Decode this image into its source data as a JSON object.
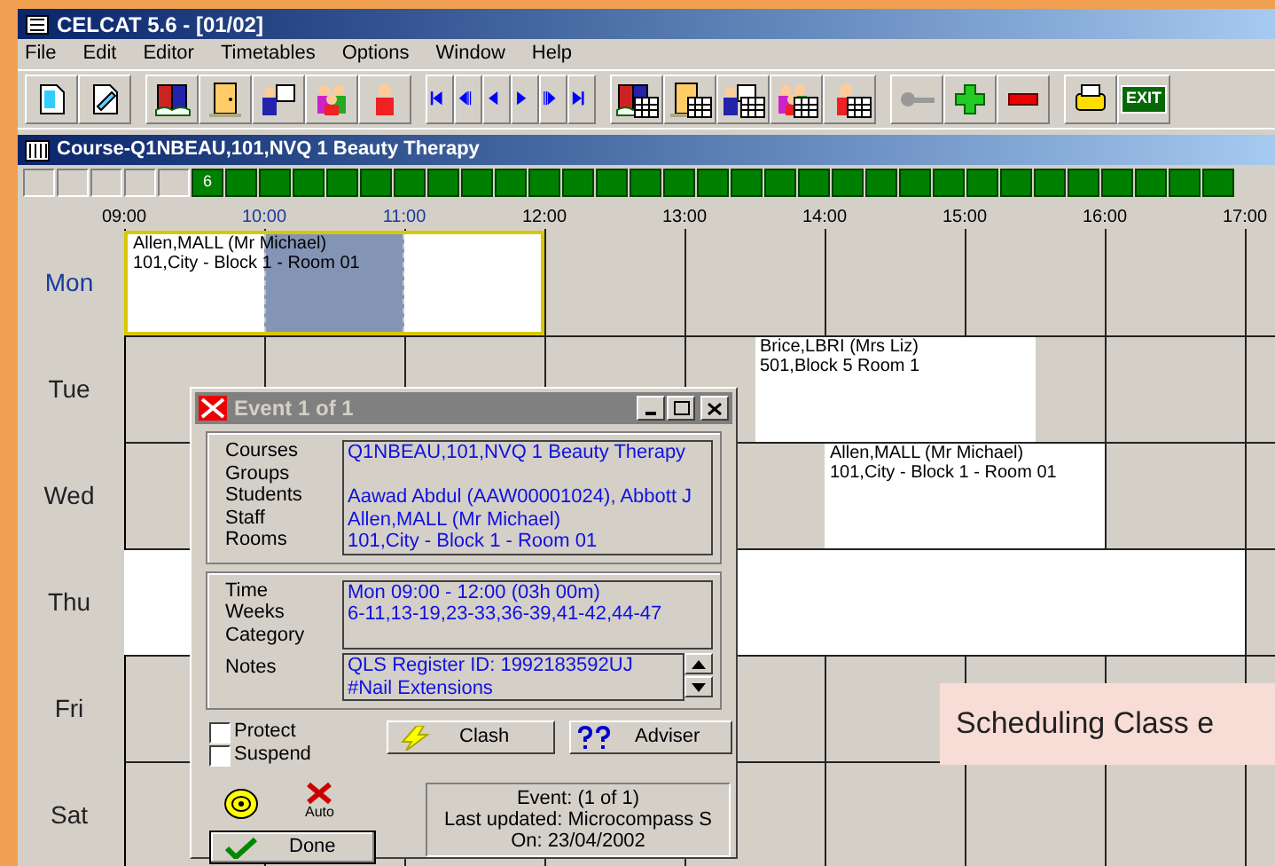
{
  "app": {
    "title": "CELCAT 5.6 - [01/02]"
  },
  "menu": [
    "File",
    "Edit",
    "Editor",
    "Timetables",
    "Options",
    "Window",
    "Help"
  ],
  "toolbar": {
    "exit_label": "EXIT"
  },
  "timetable": {
    "title": "Course-Q1NBEAU,101,NVQ 1 Beauty Therapy",
    "weeks": [
      {
        "active": false
      },
      {
        "active": false
      },
      {
        "active": false
      },
      {
        "active": false
      },
      {
        "active": false
      },
      {
        "label": "6",
        "active": true
      },
      {
        "active": true
      },
      {
        "active": true
      },
      {
        "active": true
      },
      {
        "active": true
      },
      {
        "active": true
      },
      {
        "active": true
      },
      {
        "active": true
      },
      {
        "active": true
      },
      {
        "active": true
      },
      {
        "active": true
      },
      {
        "active": true
      },
      {
        "active": true
      },
      {
        "active": true
      },
      {
        "active": true
      },
      {
        "active": true
      },
      {
        "active": true
      },
      {
        "active": true
      },
      {
        "active": true
      },
      {
        "active": true
      },
      {
        "active": true
      },
      {
        "active": true
      },
      {
        "active": true
      },
      {
        "active": true
      },
      {
        "active": true
      },
      {
        "active": true
      },
      {
        "active": true
      },
      {
        "active": true
      },
      {
        "active": true
      },
      {
        "active": true
      },
      {
        "active": true
      }
    ],
    "hours": [
      {
        "label": "09:00",
        "selected": false
      },
      {
        "label": "10:00",
        "selected": true
      },
      {
        "label": "11:00",
        "selected": true
      },
      {
        "label": "12:00",
        "selected": false
      },
      {
        "label": "13:00",
        "selected": false
      },
      {
        "label": "14:00",
        "selected": false
      },
      {
        "label": "15:00",
        "selected": false
      },
      {
        "label": "16:00",
        "selected": false
      },
      {
        "label": "17:00",
        "selected": false
      }
    ],
    "days": [
      {
        "label": "Mon",
        "selected": true
      },
      {
        "label": "Tue",
        "selected": false
      },
      {
        "label": "Wed",
        "selected": false
      },
      {
        "label": "Thu",
        "selected": false
      },
      {
        "label": "Fri",
        "selected": false
      },
      {
        "label": "Sat",
        "selected": false
      }
    ],
    "events": [
      {
        "selected": true,
        "lines": [
          "Allen,MALL (Mr Michael)",
          "101,City - Block 1 - Room 01"
        ]
      },
      {
        "selected": false,
        "lines": [
          "Brice,LBRI (Mrs Liz)",
          "501,Block 5 Room 1"
        ]
      },
      {
        "selected": false,
        "lines": [
          "Allen,MALL (Mr Michael)",
          "101,City - Block 1 - Room 01"
        ]
      },
      {
        "selected": false
      }
    ]
  },
  "tooltip": "Scheduling Class e",
  "dialog": {
    "title": "Event 1 of 1",
    "details": [
      {
        "label": "Courses",
        "value": "Q1NBEAU,101,NVQ 1 Beauty Therapy"
      },
      {
        "label": "Groups"
      },
      {
        "label": "Students",
        "value": "Aawad Abdul (AAW00001024), Abbott J"
      },
      {
        "label": "Staff",
        "value": "Allen,MALL (Mr Michael)"
      },
      {
        "label": "Rooms",
        "value": "101,City - Block 1 - Room 01"
      }
    ],
    "timing": [
      {
        "label": "Time",
        "value": "Mon 09:00 - 12:00 (03h 00m)"
      },
      {
        "label": "Weeks",
        "value": "6-11,13-19,23-33,36-39,41-42,44-47"
      },
      {
        "label": "Category"
      }
    ],
    "notes": {
      "label": "Notes",
      "lines": [
        "QLS Register ID: 1992183592UJ",
        "#Nail Extensions"
      ]
    },
    "checkboxes": [
      {
        "label": "Protect",
        "checked": false
      },
      {
        "label": "Suspend",
        "checked": false
      }
    ],
    "clash": "Clash",
    "adviser": "Adviser",
    "auto": "Auto",
    "done": "Done",
    "info": [
      "Event: (1 of 1)",
      "Last updated: Microcompass S",
      "On: 23/04/2002"
    ]
  }
}
